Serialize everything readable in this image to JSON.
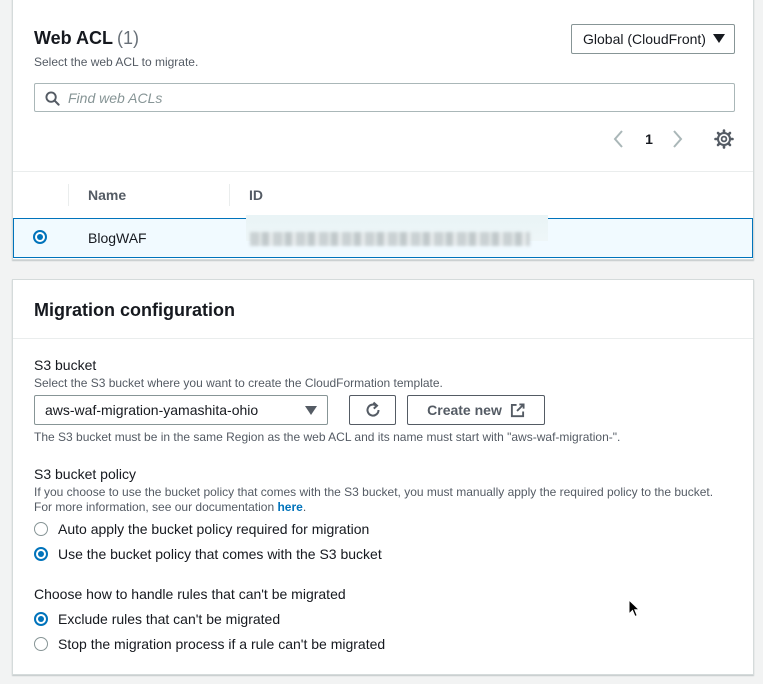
{
  "web_acl": {
    "title": "Web ACL",
    "count": "(1)",
    "description": "Select the web ACL to migrate.",
    "scope": "Global (CloudFront)",
    "search_placeholder": "Find web ACLs",
    "page": "1",
    "columns": [
      "Name",
      "ID"
    ],
    "rows": [
      {
        "name": "BlogWAF",
        "id_redacted": true,
        "selected": true
      }
    ]
  },
  "migration": {
    "title": "Migration configuration",
    "s3_bucket": {
      "label": "S3 bucket",
      "description": "Select the S3 bucket where you want to create the CloudFormation template.",
      "selected": "aws-waf-migration-yamashita-ohio",
      "create_label": "Create new",
      "hint": "The S3 bucket must be in the same Region as the web ACL and its name must start with \"aws-waf-migration-\"."
    },
    "bucket_policy": {
      "label": "S3 bucket policy",
      "description_1": "If you choose to use the bucket policy that comes with the S3 bucket, you must manually apply the required policy to the bucket.",
      "description_2": "For more information, see our documentation ",
      "link": "here",
      "period": ".",
      "options": [
        {
          "label": "Auto apply the bucket policy required for migration",
          "checked": false
        },
        {
          "label": "Use the bucket policy that comes with the S3 bucket",
          "checked": true
        }
      ]
    },
    "rules": {
      "label": "Choose how to handle rules that can't be migrated",
      "options": [
        {
          "label": "Exclude rules that can't be migrated",
          "checked": true
        },
        {
          "label": "Stop the migration process if a rule can't be migrated",
          "checked": false
        }
      ]
    }
  },
  "icons": {
    "search": "search-icon",
    "prev": "chevron-left-icon",
    "next": "chevron-right-icon",
    "settings": "gear-icon",
    "refresh": "refresh-icon",
    "external": "external-link-icon",
    "cursor": "mouse-pointer-icon"
  },
  "colors": {
    "accent": "#0073bb",
    "selected_row_bg": "#f1faff",
    "page_bg": "#f2f3f3"
  }
}
